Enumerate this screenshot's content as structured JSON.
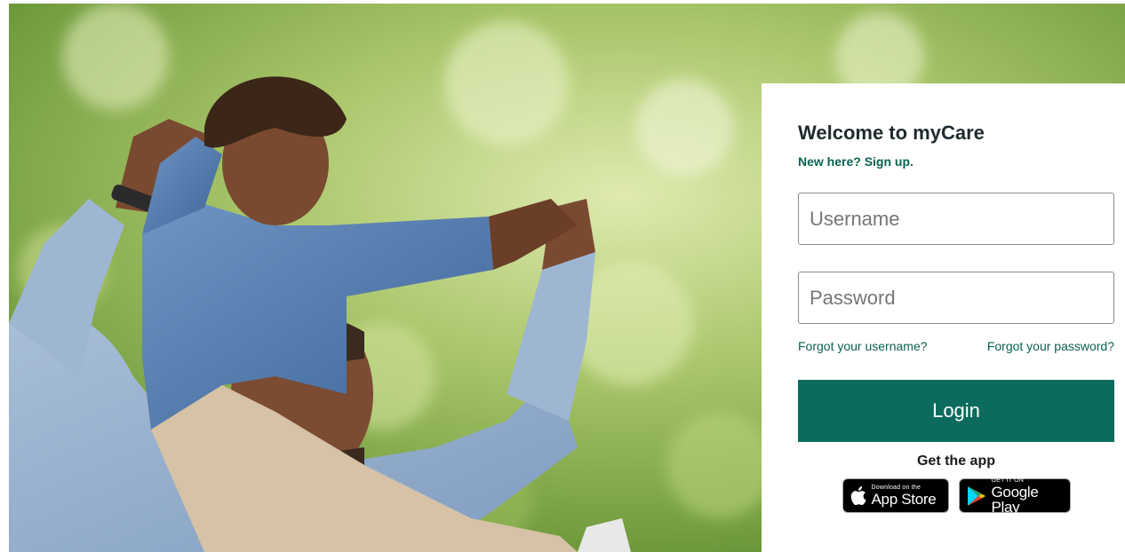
{
  "hero": {
    "image_description_icon": "hero-photo"
  },
  "login": {
    "title": "Welcome to myCare",
    "signup_text": "New here? Sign up.",
    "username_placeholder": "Username",
    "username_value": "",
    "password_placeholder": "Password",
    "password_value": "",
    "forgot_username": "Forgot your username?",
    "forgot_password": "Forgot your password?",
    "login_label": "Login",
    "get_app_label": "Get the app"
  },
  "badges": {
    "appstore_small": "Download on the",
    "appstore_big": "App Store",
    "appstore_icon": "apple-icon",
    "googleplay_small": "GET IT ON",
    "googleplay_big": "Google Play",
    "googleplay_icon": "google-play-icon"
  },
  "colors": {
    "accent": "#0b6b5c",
    "link": "#0b6152",
    "title": "#1f2a2e"
  }
}
